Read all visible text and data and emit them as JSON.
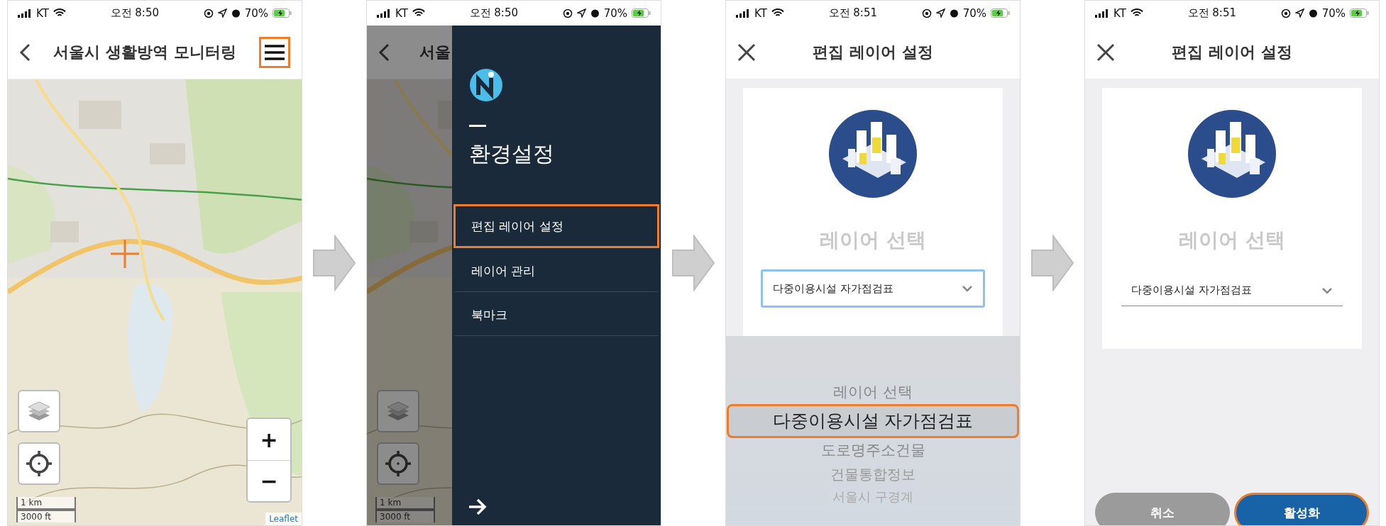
{
  "screens": [
    {
      "kind": "map",
      "status": {
        "carrier": "KT",
        "time": "오전 8:50",
        "battery": "70%"
      },
      "header": {
        "title": "서울시 생활방역 모니터링",
        "menu_highlighted": true
      },
      "map": {
        "scale": [
          "1 km",
          "3000 ft"
        ],
        "zoom_in": "+",
        "zoom_out": "−",
        "attribution": "Leaflet"
      }
    },
    {
      "kind": "drawer",
      "status": {
        "carrier": "KT",
        "time": "오전 8:50",
        "battery": "70%"
      },
      "behind": {
        "title": "서울",
        "scale": [
          "1 km",
          "3000 ft"
        ]
      },
      "drawer": {
        "heading": "환경설정",
        "items": [
          {
            "label": "편집 레이어 설정",
            "highlighted": true
          },
          {
            "label": "레이어 관리",
            "highlighted": false
          },
          {
            "label": "북마크",
            "highlighted": false
          }
        ]
      }
    },
    {
      "kind": "picker",
      "status": {
        "carrier": "KT",
        "time": "오전 8:51",
        "battery": "70%"
      },
      "header": {
        "title": "편집 레이어 설정"
      },
      "card": {
        "label": "레이어 선택",
        "select": {
          "value": "다중이용시설 자가점검표",
          "focused": true
        }
      },
      "picker": {
        "options": [
          {
            "label": "레이어 선택",
            "selected": false,
            "highlighted": false
          },
          {
            "label": "다중이용시설 자가점검표",
            "selected": true,
            "highlighted": true
          },
          {
            "label": "도로명주소건물",
            "selected": false,
            "highlighted": false
          },
          {
            "label": "건물통합정보",
            "selected": false,
            "highlighted": false
          },
          {
            "label": "서울시 구경계",
            "selected": false,
            "highlighted": false
          }
        ]
      }
    },
    {
      "kind": "confirm",
      "status": {
        "carrier": "KT",
        "time": "오전 8:51",
        "battery": "70%"
      },
      "header": {
        "title": "편집 레이어 설정"
      },
      "card": {
        "label": "레이어 선택",
        "select": {
          "value": "다중이용시설 자가점검표",
          "focused": false
        }
      },
      "buttons": [
        {
          "label": "취소",
          "kind": "cancel",
          "highlighted": false
        },
        {
          "label": "활성화",
          "kind": "primary",
          "highlighted": true
        }
      ]
    }
  ]
}
